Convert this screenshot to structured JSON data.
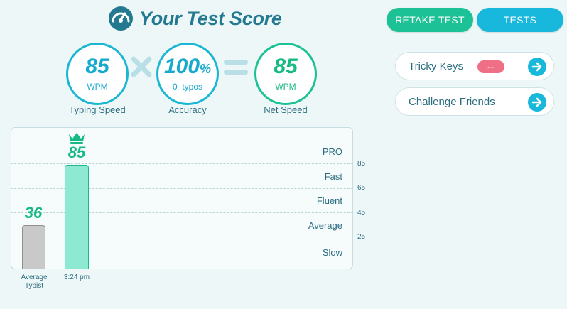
{
  "header": {
    "title": "Your Test Score",
    "retake_label": "RETAKE TEST",
    "tests_label": "TESTS"
  },
  "stats": {
    "typing_speed": {
      "value": "85",
      "unit": "WPM",
      "label": "Typing Speed"
    },
    "accuracy": {
      "value": "100",
      "pct": "%",
      "unit": "0  typos",
      "label": "Accuracy"
    },
    "net_speed": {
      "value": "85",
      "unit": "WPM",
      "label": "Net Speed"
    }
  },
  "actions": {
    "tricky_keys": {
      "label": "Tricky Keys",
      "badge": "--"
    },
    "challenge": {
      "label": "Challenge Friends"
    }
  },
  "chart_data": {
    "type": "bar",
    "categories": [
      "Average Typist",
      "3:24 pm"
    ],
    "values": [
      36,
      85
    ],
    "value_labels": [
      "36",
      "85"
    ],
    "levels": [
      "PRO",
      "Fast",
      "Fluent",
      "Average",
      "Slow"
    ],
    "ticks": [
      "85",
      "65",
      "45",
      "25"
    ],
    "ylim": [
      0,
      100
    ]
  },
  "colors": {
    "primary": "#17b8db",
    "green": "#1cc295",
    "badge": "#ef6f86"
  },
  "icons": {
    "title": "speedometer-icon",
    "crown": "crown-icon",
    "arrow": "arrow-right-icon",
    "times": "times-icon",
    "equals": "equals-icon"
  }
}
